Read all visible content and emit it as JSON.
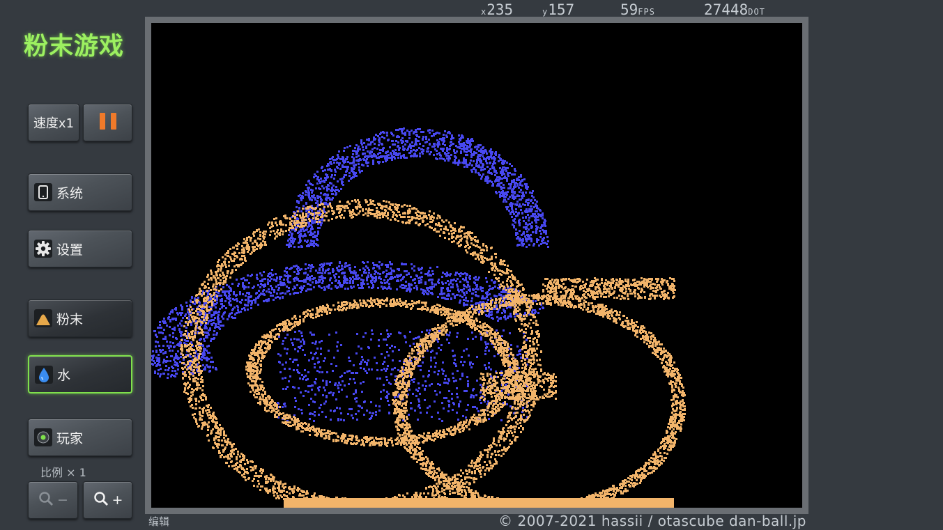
{
  "app": {
    "title": "粉末游戏"
  },
  "controls": {
    "speed_label": "速度x1",
    "pause_icon": "pause-icon",
    "system_label": "系统",
    "settings_label": "设置",
    "powder_label": "粉末",
    "water_label": "水",
    "player_label": "玩家",
    "scale_label": "比例 × 1",
    "zoom_out_label": "−",
    "zoom_in_label": "+"
  },
  "stats": {
    "x_prefix": "x",
    "x_value": "235",
    "y_prefix": "y",
    "y_value": "157",
    "fps_value": "59",
    "fps_unit": "FPS",
    "dot_value": "27448",
    "dot_unit": "DOT"
  },
  "footer": {
    "edit_label": "编辑",
    "copyright": "© 2007-2021 hassii / otascube  dan-ball.jp"
  },
  "colors": {
    "accent_green": "#7fe04c",
    "pause_orange": "#f07a2a",
    "powder": "#f2b46a",
    "water": "#4848f0",
    "canvas_bg": "#000000"
  },
  "selected_element": "水"
}
